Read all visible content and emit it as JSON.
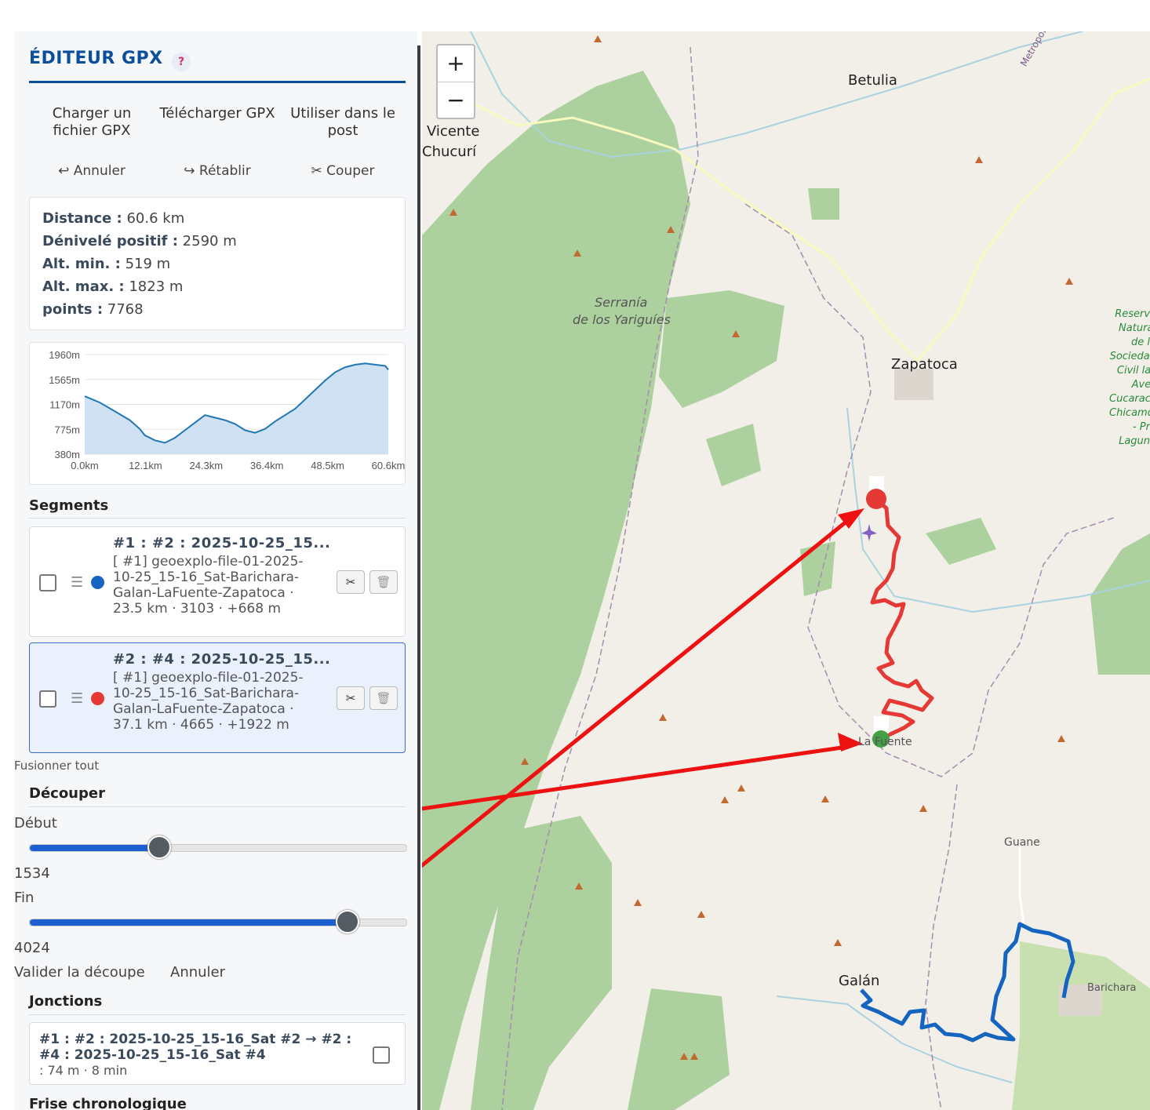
{
  "panel": {
    "title": "ÉDITEUR GPX",
    "help_symbol": "?",
    "actions": [
      "Charger un fichier GPX",
      "Télécharger GPX",
      "Utiliser dans le post"
    ],
    "edit_actions": {
      "undo": {
        "icon": "undo-icon",
        "glyph": "↩",
        "label": "Annuler"
      },
      "redo": {
        "icon": "redo-icon",
        "glyph": "↪",
        "label": "Rétablir"
      },
      "cut": {
        "icon": "scissors-icon",
        "glyph": "✂",
        "label": "Couper"
      }
    },
    "stats": [
      {
        "label": "Distance :",
        "value": "60.6 km"
      },
      {
        "label": "Dénivelé positif :",
        "value": "2590 m"
      },
      {
        "label": "Alt. min. :",
        "value": "519 m"
      },
      {
        "label": "Alt. max. :",
        "value": "1823 m"
      },
      {
        "label": "points :",
        "value": "7768"
      }
    ],
    "segments_title": "Segments",
    "segments": [
      {
        "name": "#1 : #2 : 2025-10-25_15...",
        "description": "[ #1] geoexplo-file-01-2025-10-25_15-16_Sat-Barichara-Galan-LaFuente-Zapatoca · 23.5 km · 3103 · +668 m",
        "color": "#1565c0",
        "selected": false
      },
      {
        "name": "#2 : #4 : 2025-10-25_15...",
        "description": "[ #1] geoexplo-file-01-2025-10-25_15-16_Sat-Barichara-Galan-LaFuente-Zapatoca · 37.1 km · 4665 · +1922 m",
        "color": "#e53935",
        "selected": true
      }
    ],
    "merge_all": "Fusionner tout",
    "cut_section": {
      "title": "Découper",
      "start_label": "Début",
      "start_value": "1534",
      "start_fraction": 0.34,
      "end_label": "Fin",
      "end_value": "4024",
      "end_fraction": 0.84,
      "confirm": "Valider la découpe",
      "cancel": "Annuler"
    },
    "junctions_title": "Jonctions",
    "junctions": [
      {
        "text": "#1 : #2 : 2025-10-25_15-16_Sat #2 → #2 : #4 : 2025-10-25_15-16_Sat #4",
        "detail": ": 74 m · 8 min"
      }
    ],
    "timeline_title": "Frise chronologique"
  },
  "chart_data": {
    "type": "area",
    "y_ticks": [
      "1960m",
      "1565m",
      "1170m",
      "775m",
      "380m"
    ],
    "x_ticks": [
      "0.0km",
      "12.1km",
      "24.3km",
      "36.4km",
      "48.5km",
      "60.6km"
    ],
    "ylim": [
      380,
      1960
    ],
    "xlim": [
      0,
      60.6
    ],
    "x": [
      0,
      3,
      6,
      9,
      11,
      12,
      14,
      16,
      18,
      20,
      22,
      24,
      26,
      28,
      30,
      32,
      34,
      36,
      38,
      40,
      42,
      44,
      46,
      48,
      50,
      52,
      54,
      56,
      58,
      60,
      60.6
    ],
    "y": [
      1300,
      1200,
      1060,
      920,
      780,
      680,
      600,
      560,
      640,
      760,
      880,
      1000,
      960,
      920,
      860,
      760,
      720,
      780,
      900,
      1000,
      1100,
      1250,
      1400,
      1550,
      1680,
      1760,
      1800,
      1820,
      1800,
      1780,
      1720
    ],
    "line_color": "#1f77b4",
    "fill_color": "#cfe1f3"
  },
  "map": {
    "zoom_in": "+",
    "zoom_out": "−",
    "places": [
      {
        "name": "Betulia"
      },
      {
        "name": "Vicente"
      },
      {
        "name": "Chucurí"
      },
      {
        "name": "Serranía"
      },
      {
        "name": "de los Yariguíes"
      },
      {
        "name": "Zapatoca"
      },
      {
        "name": "Metropolitana"
      },
      {
        "name": "La Fuente"
      },
      {
        "name": "Guane"
      },
      {
        "name": "Galán"
      },
      {
        "name": "Barichara"
      },
      {
        "name": "Reserva Natural de la Sociedad Civil las Aves Cucarachero Chicamocha - Pre Laguna"
      }
    ],
    "track_colors": {
      "red": "#e53935",
      "blue": "#1565c0",
      "annotation": "#ee1111"
    }
  }
}
